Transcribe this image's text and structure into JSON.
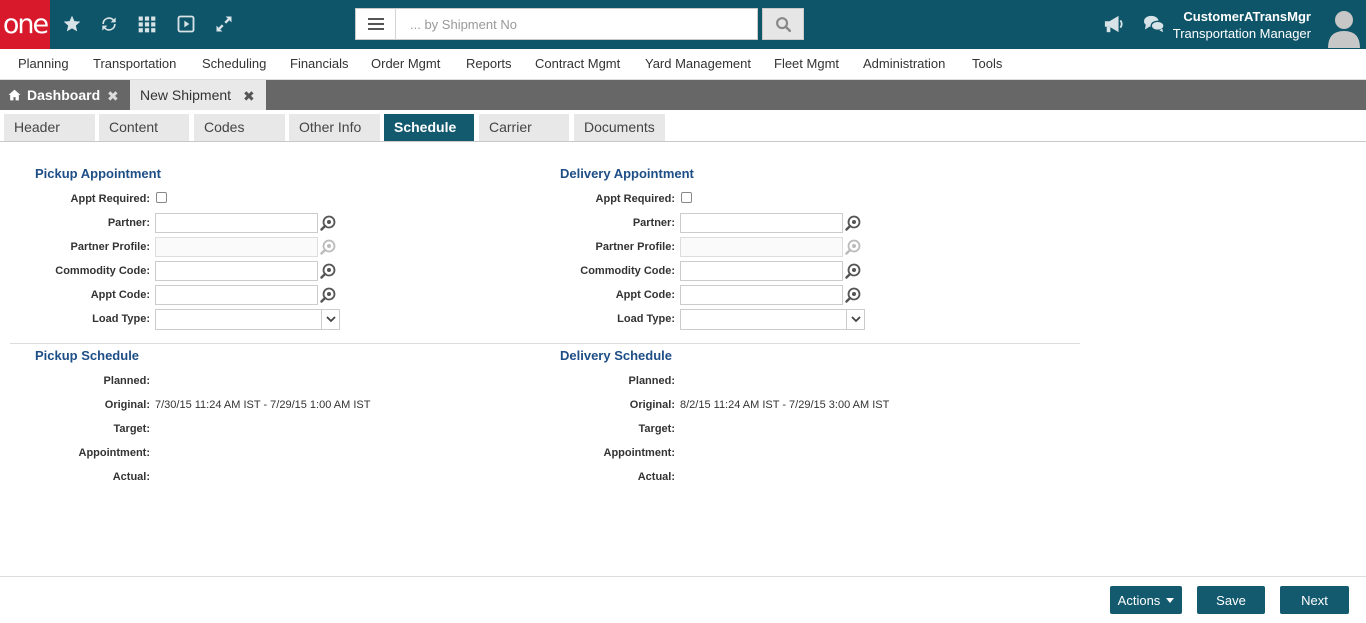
{
  "app": {
    "logo": "one",
    "search_placeholder": "... by Shipment No",
    "user_name": "CustomerATransMgr",
    "user_role": "Transportation Manager"
  },
  "menu": [
    "Planning",
    "Transportation",
    "Scheduling",
    "Financials",
    "Order Mgmt",
    "Reports",
    "Contract Mgmt",
    "Yard Management",
    "Fleet Mgmt",
    "Administration",
    "Tools"
  ],
  "page_tabs": {
    "dashboard": "Dashboard",
    "new_shipment": "New Shipment"
  },
  "sub_tabs": [
    "Header",
    "Content",
    "Codes",
    "Other Info",
    "Schedule",
    "Carrier",
    "Documents"
  ],
  "active_sub_tab": "Schedule",
  "pickup_appt": {
    "title": "Pickup Appointment",
    "appt_required": "Appt Required:",
    "partner": "Partner:",
    "partner_profile": "Partner Profile:",
    "commodity_code": "Commodity Code:",
    "appt_code": "Appt Code:",
    "load_type": "Load Type:"
  },
  "delivery_appt": {
    "title": "Delivery Appointment",
    "appt_required": "Appt Required:",
    "partner": "Partner:",
    "partner_profile": "Partner Profile:",
    "commodity_code": "Commodity Code:",
    "appt_code": "Appt Code:",
    "load_type": "Load Type:"
  },
  "pickup_schedule": {
    "title": "Pickup Schedule",
    "planned": "Planned:",
    "original": "Original:",
    "original_value": "7/30/15 11:24 AM IST - 7/29/15 1:00 AM IST",
    "target": "Target:",
    "appointment": "Appointment:",
    "actual": "Actual:"
  },
  "delivery_schedule": {
    "title": "Delivery Schedule",
    "planned": "Planned:",
    "original": "Original:",
    "original_value": "8/2/15 11:24 AM IST - 7/29/15 3:00 AM IST",
    "target": "Target:",
    "appointment": "Appointment:",
    "actual": "Actual:"
  },
  "buttons": {
    "actions": "Actions",
    "save": "Save",
    "next": "Next"
  },
  "colors": {
    "topbar": "#0f5569",
    "logo": "#d7192b",
    "accent": "#145a6f",
    "section_title": "#1e4e86"
  }
}
